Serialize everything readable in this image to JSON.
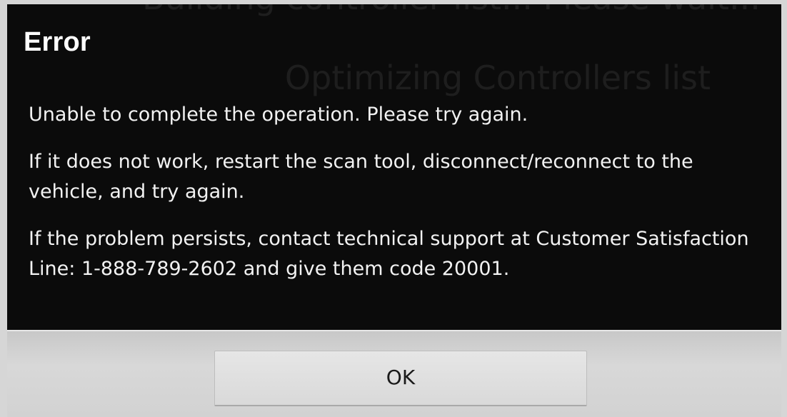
{
  "background": {
    "top_text": "Building controller list... Please wait...",
    "middle_text": "Optimizing Controllers list"
  },
  "dialog": {
    "title": "Error",
    "paragraphs": [
      "Unable to complete the operation. Please try again.",
      "If it does not work, restart the scan tool, disconnect/reconnect to the vehicle, and try again.",
      "If the problem persists, contact technical support at Customer Satisfaction Line: 1-888-789-2602 and give them code 20001."
    ],
    "ok_label": "OK"
  },
  "colors": {
    "dialog_background": "#0b0b0b",
    "text": "#f2f2f2",
    "footer": "#d2d2d2"
  }
}
